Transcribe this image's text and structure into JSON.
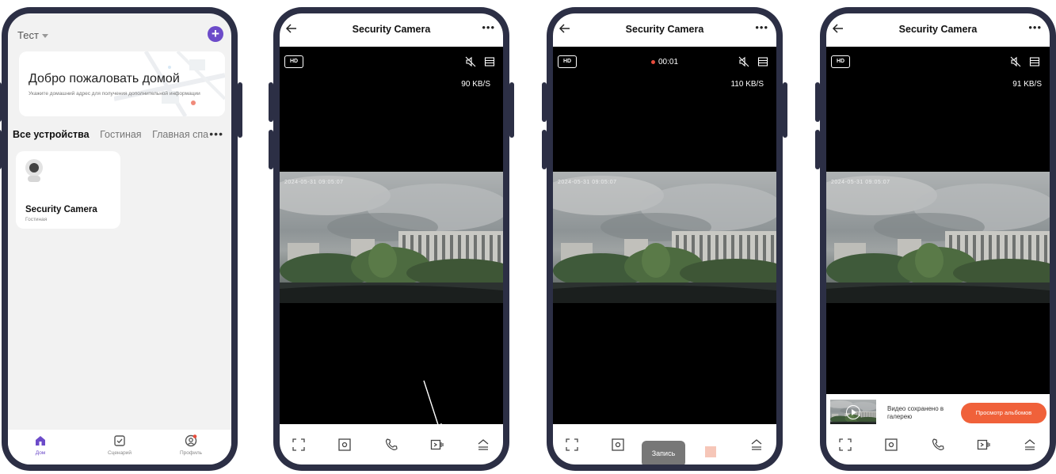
{
  "home": {
    "home_name": "Тест",
    "welcome_title": "Добро пожаловать домой",
    "welcome_subtitle": "Укажите домашний адрес для получения дополнительной информации",
    "tabs": [
      "Все устройства",
      "Гостиная",
      "Главная спа"
    ],
    "device": {
      "name": "Security Camera",
      "room": "Гостиная"
    },
    "nav": [
      "Дом",
      "Сценарий",
      "Профиль"
    ]
  },
  "camera": {
    "title": "Security Camera",
    "hd": "HD",
    "timestamp": "2024-05-31 09:05:07",
    "controls": [
      "fullscreen-icon",
      "screenshot-icon",
      "phone-icon",
      "record-icon",
      "expand-icon"
    ]
  },
  "screens": [
    {
      "speed": "90 KB/S"
    },
    {
      "speed": "110 KB/S",
      "timer": "00:01",
      "toast": "Запись"
    },
    {
      "speed": "91 KB/S",
      "saved_text": "Видео сохранено в галерею",
      "album_button": "Просмотр альбомов"
    }
  ],
  "colors": {
    "accent": "#6c4bc9",
    "orange": "#f0613a",
    "frame": "#2c2f45",
    "record_dot": "#e74c3c"
  }
}
